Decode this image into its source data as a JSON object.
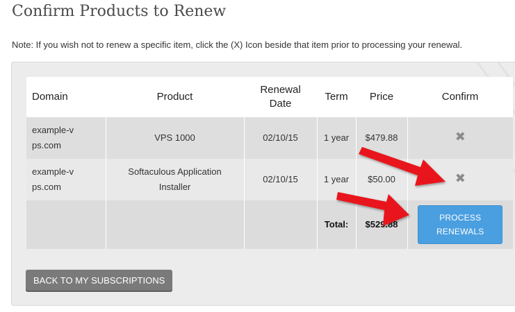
{
  "title": "Confirm Products to Renew",
  "note": "Note: If you wish not to renew a specific item, click the (X) Icon beside that item prior to processing your renewal.",
  "table": {
    "headers": {
      "domain": "Domain",
      "product": "Product",
      "renewal_date": "Renewal Date",
      "term": "Term",
      "price": "Price",
      "confirm": "Confirm"
    },
    "rows": [
      {
        "domain": "example-vps.com",
        "product": "VPS 1000",
        "renewal_date": "02/10/15",
        "term": "1 year",
        "price": "$479.88",
        "remove_icon": "close-x-icon"
      },
      {
        "domain": "example-vps.com",
        "product": "Softaculous Application Installer",
        "renewal_date": "02/10/15",
        "term": "1 year",
        "price": "$50.00",
        "remove_icon": "close-x-icon"
      }
    ],
    "total_label": "Total:",
    "total_value": "$529.88"
  },
  "buttons": {
    "process_renewals": "PROCESS RENEWALS",
    "back": "BACK TO MY SUBSCRIPTIONS"
  },
  "colors": {
    "process_button": "#4a9fe0",
    "back_button": "#7a7a7a",
    "annotation_arrow": "#e8121b"
  }
}
